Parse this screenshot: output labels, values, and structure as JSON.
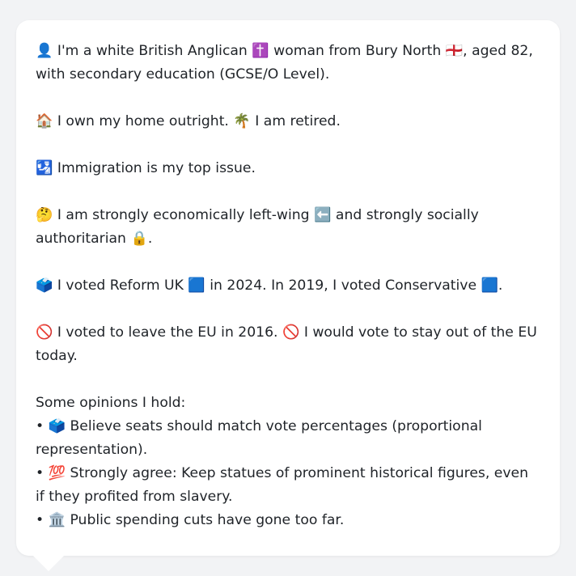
{
  "profile": {
    "identity": {
      "icon_person": "👤",
      "text1": "I'm a white British Anglican",
      "icon_cross": "✝️",
      "text2": "woman from Bury North",
      "icon_flag": "🏴󠁧󠁢󠁥󠁮󠁧󠁿",
      "text3": ", aged 82, with secondary education (GCSE/O Level)."
    },
    "home": {
      "icon_house": "🏠",
      "text1": "I own my home outright.",
      "icon_palm": "🌴",
      "text2": "I am retired."
    },
    "issue": {
      "icon": "🛂",
      "text": "Immigration is my top issue."
    },
    "politics": {
      "icon_think": "🤔",
      "text1": "I am strongly economically left-wing",
      "icon_left": "⬅️",
      "text2": "and strongly socially authoritarian",
      "icon_lock": "🔒",
      "text3": "."
    },
    "votes": {
      "icon_ballot": "🗳️",
      "text1": "I voted Reform UK",
      "icon_reform": "🟦",
      "text2": "in 2024. In 2019, I voted Conservative",
      "icon_con": "🟦",
      "text3": "."
    },
    "eu": {
      "icon1": "🚫",
      "text1": "I voted to leave the EU in 2016.",
      "icon2": "🚫",
      "text2": "I would vote to stay out of the EU today."
    },
    "opinions": {
      "heading": "Some opinions I hold:",
      "bullet": "•",
      "items": [
        {
          "icon": "🗳️",
          "text": "Believe seats should match vote percentages (proportional representation)."
        },
        {
          "icon": "💯",
          "text": "Strongly agree: Keep statues of prominent historical figures, even if they profited from slavery."
        },
        {
          "icon": "🏛️",
          "text": "Public spending cuts have gone too far."
        }
      ]
    }
  }
}
